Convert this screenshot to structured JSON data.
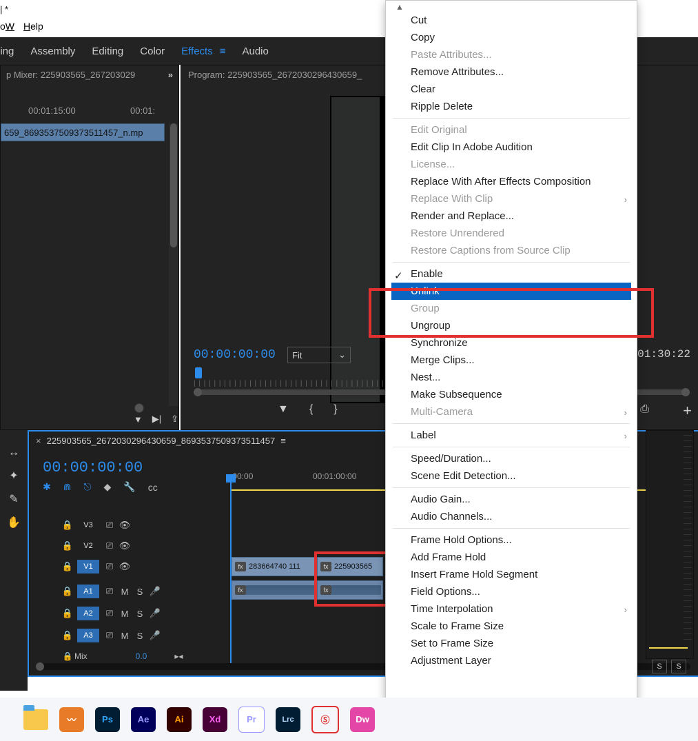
{
  "title_fragment": "| *",
  "menubar": {
    "window": "Window",
    "help": "Help",
    "window_u": "W",
    "help_u": "H"
  },
  "workspaces": {
    "learning": "ning",
    "assembly": "Assembly",
    "editing": "Editing",
    "color": "Color",
    "effects": "Effects",
    "audio": "Audio"
  },
  "mixer": {
    "title": "p Mixer: 225903565_267203029",
    "tc1": "00:01:15:00",
    "tc2": "00:01:",
    "clip": "659_8693537509373511457_n.mp"
  },
  "program": {
    "title": "Program: 225903565_2672030296430659_",
    "tc": "00:00:00:00",
    "fit": "Fit",
    "end_tc": ":01:30:22"
  },
  "timeline": {
    "name": "225903565_2672030296430659_8693537509373511457",
    "tc": "00:00:00:00",
    "ruler_t0": ":00:00",
    "ruler_t1": "00:01:00:00",
    "tracks": {
      "v3": "V3",
      "v2": "V2",
      "v1": "V1",
      "a1": "A1",
      "a2": "A2",
      "a3": "A3",
      "mix": "Mix",
      "mix_val": "0.0"
    },
    "btn": {
      "m": "M",
      "s": "S"
    },
    "clip_v_a": "283664740  111",
    "clip_v_b": "225903565",
    "fx": "fx"
  },
  "context_menu": {
    "items": [
      {
        "label": "Cut"
      },
      {
        "label": "Copy"
      },
      {
        "label": "Paste Attributes...",
        "disabled": true
      },
      {
        "label": "Remove Attributes..."
      },
      {
        "label": "Clear"
      },
      {
        "label": "Ripple Delete"
      },
      {
        "sep": true
      },
      {
        "label": "Edit Original",
        "disabled": true
      },
      {
        "label": "Edit Clip In Adobe Audition"
      },
      {
        "label": "License...",
        "disabled": true
      },
      {
        "label": "Replace With After Effects Composition"
      },
      {
        "label": "Replace With Clip",
        "disabled": true,
        "submenu": true
      },
      {
        "label": "Render and Replace..."
      },
      {
        "label": "Restore Unrendered",
        "disabled": true
      },
      {
        "label": "Restore Captions from Source Clip",
        "disabled": true
      },
      {
        "sep": true
      },
      {
        "label": "Enable",
        "checked": true
      },
      {
        "label": "Unlink",
        "highlight": true
      },
      {
        "label": "Group",
        "disabled": true
      },
      {
        "label": "Ungroup"
      },
      {
        "label": "Synchronize"
      },
      {
        "label": "Merge Clips..."
      },
      {
        "label": "Nest..."
      },
      {
        "label": "Make Subsequence"
      },
      {
        "label": "Multi-Camera",
        "disabled": true,
        "submenu": true
      },
      {
        "sep": true
      },
      {
        "label": "Label",
        "submenu": true
      },
      {
        "sep": true
      },
      {
        "label": "Speed/Duration..."
      },
      {
        "label": "Scene Edit Detection..."
      },
      {
        "sep": true
      },
      {
        "label": "Audio Gain..."
      },
      {
        "label": "Audio Channels..."
      },
      {
        "sep": true
      },
      {
        "label": "Frame Hold Options..."
      },
      {
        "label": "Add Frame Hold"
      },
      {
        "label": "Insert Frame Hold Segment"
      },
      {
        "label": "Field Options..."
      },
      {
        "label": "Time Interpolation",
        "submenu": true
      },
      {
        "label": "Scale to Frame Size"
      },
      {
        "label": "Set to Frame Size"
      },
      {
        "label": "Adjustment Layer"
      }
    ]
  },
  "taskbar": {
    "ps": "Ps",
    "ae": "Ae",
    "ai": "Ai",
    "xd": "Xd",
    "pr": "Pr",
    "lrc": "Lrc",
    "dw": "Dw"
  },
  "meters": {
    "s": "S"
  }
}
